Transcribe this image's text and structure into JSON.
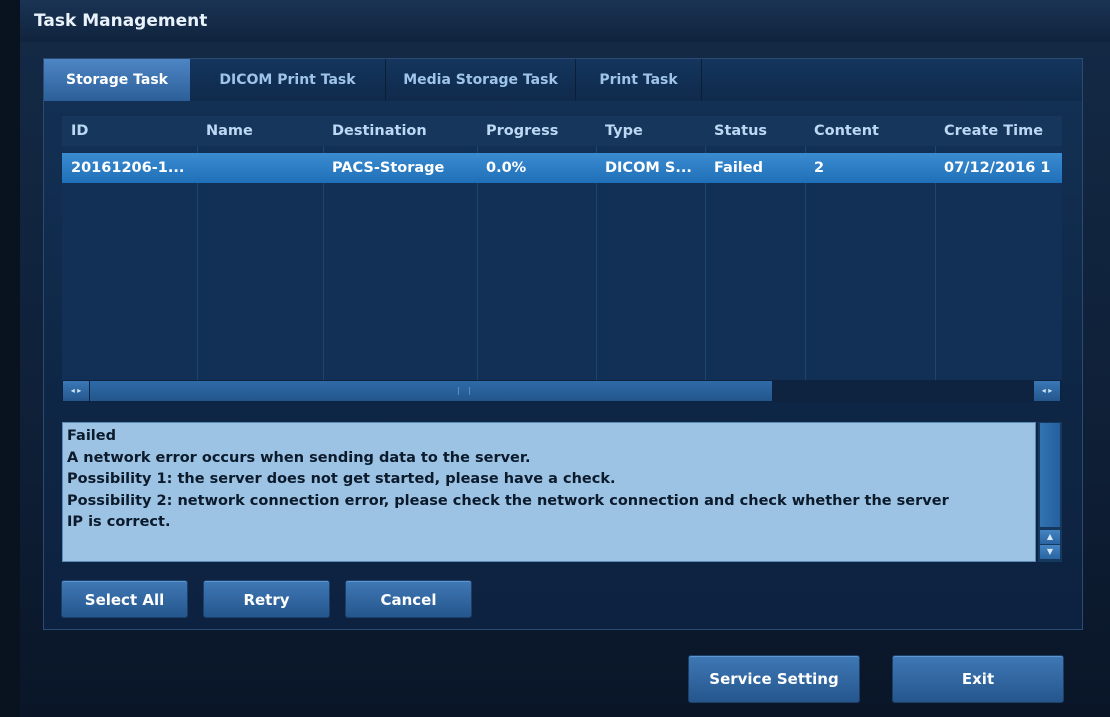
{
  "window": {
    "title": "Task Management"
  },
  "tabs": [
    {
      "label": "Storage Task",
      "active": true
    },
    {
      "label": "DICOM Print Task",
      "active": false
    },
    {
      "label": "Media Storage Task",
      "active": false
    },
    {
      "label": "Print Task",
      "active": false
    }
  ],
  "table": {
    "columns": [
      "ID",
      "Name",
      "Destination",
      "Progress",
      "Type",
      "Status",
      "Content",
      "Create Time"
    ],
    "rows": [
      {
        "cells": [
          "20161206-1...",
          "",
          "PACS-Storage",
          "0.0%",
          "DICOM S...",
          "Failed",
          "2",
          "07/12/2016 1"
        ],
        "selected": true
      }
    ]
  },
  "scrollbar": {
    "left_arrows": "◂ ▸",
    "right_arrows": "◂ ▸",
    "up_arrow": "▲",
    "down_arrow": "▼"
  },
  "message": {
    "lines": [
      "Failed",
      "A network error occurs when sending data to the server.",
      "Possibility 1: the server does not get started, please have a check.",
      "Possibility 2: network connection error, please check the network connection and check whether the server",
      " IP is correct."
    ]
  },
  "actions": {
    "select_all": "Select All",
    "retry": "Retry",
    "cancel": "Cancel"
  },
  "footer": {
    "service_setting": "Service Setting",
    "exit": "Exit"
  },
  "colors": {
    "selected_row": "#2f80c8",
    "message_bg": "#9cc2e4",
    "tab_active": "#3c74b0"
  }
}
